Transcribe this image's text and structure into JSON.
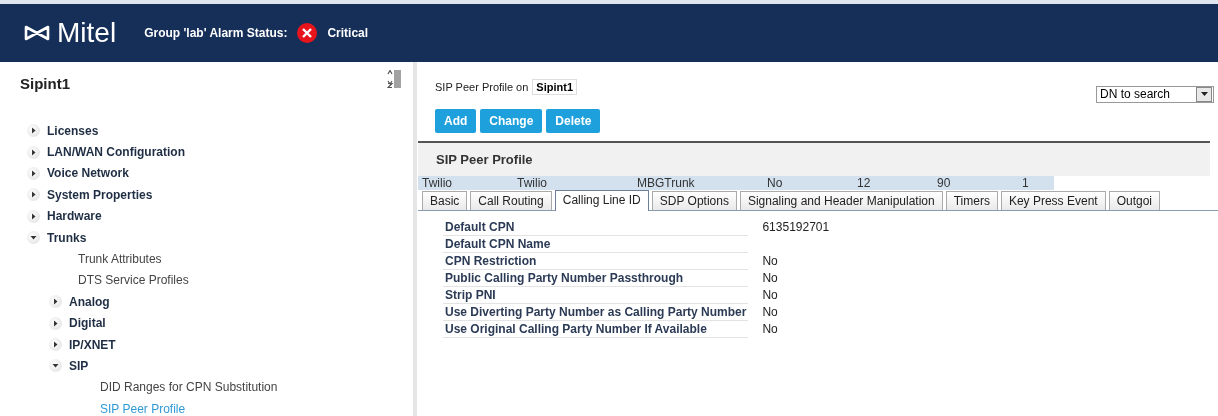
{
  "header": {
    "logo": "Mitel",
    "alarm_label": "Group 'lab' Alarm Status:",
    "alarm_text": "Critical"
  },
  "sidebar": {
    "title": "Sipint1",
    "tree": [
      {
        "kind": "folder",
        "label": "Licenses",
        "expanded": false
      },
      {
        "kind": "folder",
        "label": "LAN/WAN Configuration",
        "expanded": false
      },
      {
        "kind": "folder",
        "label": "Voice Network",
        "expanded": false
      },
      {
        "kind": "folder",
        "label": "System Properties",
        "expanded": false
      },
      {
        "kind": "folder",
        "label": "Hardware",
        "expanded": false
      },
      {
        "kind": "folder",
        "label": "Trunks",
        "expanded": true,
        "children": [
          {
            "kind": "page",
            "label": "Trunk Attributes",
            "selected": false
          },
          {
            "kind": "page",
            "label": "DTS Service Profiles",
            "selected": false
          },
          {
            "kind": "folder",
            "label": "Analog",
            "expanded": false
          },
          {
            "kind": "folder",
            "label": "Digital",
            "expanded": false
          },
          {
            "kind": "folder",
            "label": "IP/XNET",
            "expanded": false
          },
          {
            "kind": "folder",
            "label": "SIP",
            "expanded": true,
            "children": [
              {
                "kind": "page",
                "label": "DID Ranges for CPN Substitution",
                "selected": false
              },
              {
                "kind": "page",
                "label": "SIP Peer Profile",
                "selected": true
              }
            ]
          }
        ]
      }
    ]
  },
  "content": {
    "heading_prefix": "SIP Peer Profile on",
    "heading_system": "Sipint1",
    "search_select": "DN to search",
    "buttons": [
      "Add",
      "Change",
      "Delete"
    ],
    "section_title": "SIP Peer Profile",
    "summary_row": [
      "Twilio",
      "Twilio",
      "MBGTrunk",
      "No",
      "12",
      "90",
      "1"
    ],
    "tabs": [
      {
        "label": "Basic",
        "selected": false
      },
      {
        "label": "Call Routing",
        "selected": false
      },
      {
        "label": "Calling Line ID",
        "selected": true
      },
      {
        "label": "SDP Options",
        "selected": false
      },
      {
        "label": "Signaling and Header Manipulation",
        "selected": false
      },
      {
        "label": "Timers",
        "selected": false
      },
      {
        "label": "Key Press Event",
        "selected": false
      },
      {
        "label": "Outgoi",
        "selected": false
      }
    ],
    "fields": [
      {
        "label": "Default CPN",
        "value": "6135192701"
      },
      {
        "label": "Default CPN Name"
      },
      {
        "label": "CPN Restriction",
        "value": "No"
      },
      {
        "label": "Public Calling Party Number Passthrough",
        "value": "No"
      },
      {
        "label": "Strip PNI",
        "value": "No"
      },
      {
        "label": "Use Diverting Party Number as Calling Party Number",
        "value": "No"
      },
      {
        "label": "Use Original Calling Party Number If Available",
        "value": "No"
      }
    ]
  }
}
